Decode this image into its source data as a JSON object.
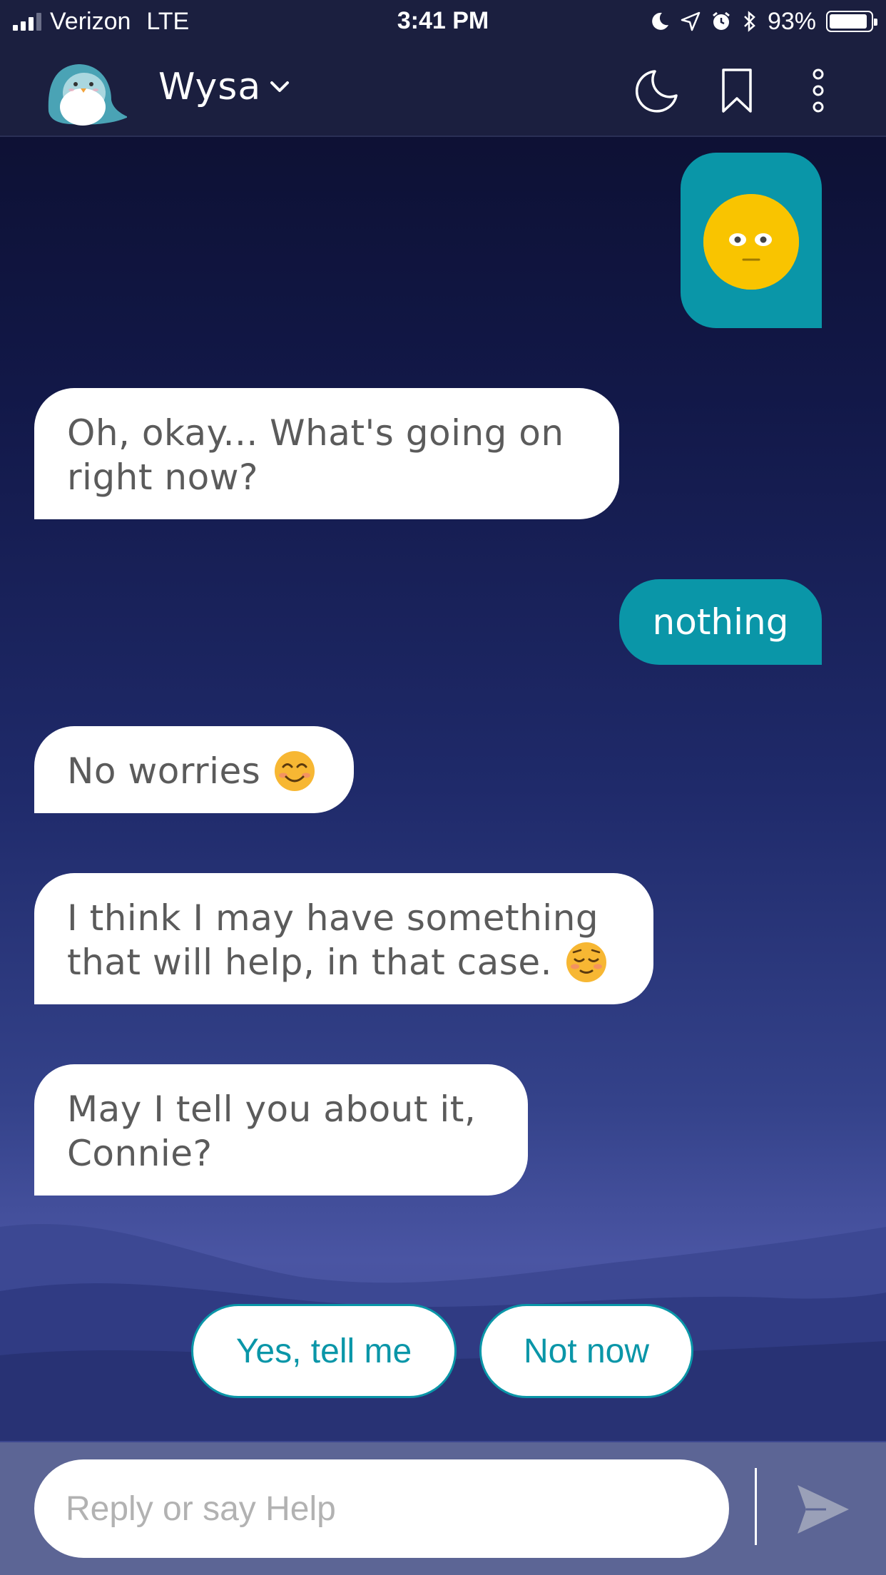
{
  "status": {
    "carrier": "Verizon",
    "network": "LTE",
    "time": "3:41 PM",
    "battery": "93%",
    "battery_level": 0.93
  },
  "header": {
    "bot_name": "Wysa"
  },
  "messages": [
    {
      "from": "user",
      "type": "sticker",
      "icon": "neutral-face-sticker"
    },
    {
      "from": "bot",
      "lines": [
        "Oh, okay... What's going on",
        "right now?"
      ]
    },
    {
      "from": "user",
      "text": "nothing"
    },
    {
      "from": "bot",
      "text": "No worries",
      "emoji": "smiling-face-emoji"
    },
    {
      "from": "bot",
      "lines": [
        "I think I may have something",
        "that will help, in that case."
      ],
      "emoji": "relieved-face-emoji"
    },
    {
      "from": "bot",
      "lines": [
        "May I tell you about it,",
        "Connie?"
      ]
    }
  ],
  "quick_replies": [
    "Yes, tell me",
    "Not now"
  ],
  "composer": {
    "placeholder": "Reply or say Help"
  },
  "colors": {
    "accent": "#0a96a8",
    "header_bg": "#1b1f3f",
    "composer_bg": "#5c6595"
  }
}
